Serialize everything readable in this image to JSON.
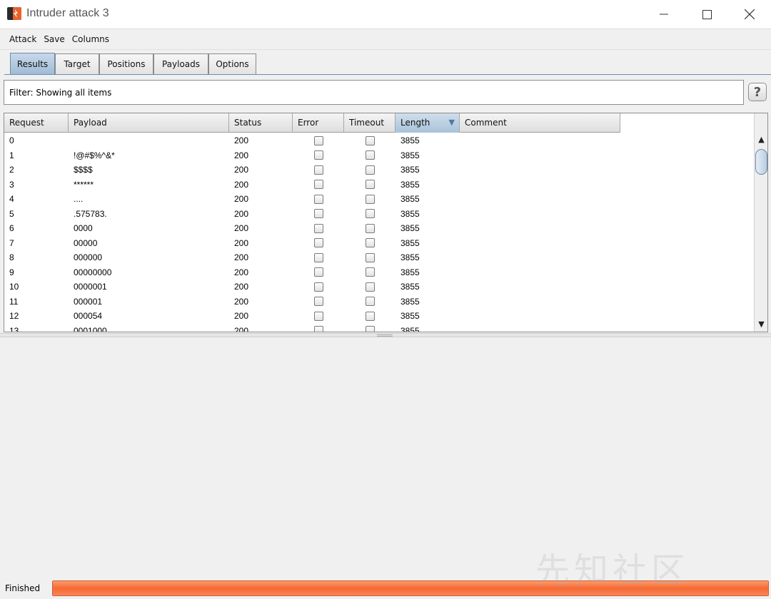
{
  "window": {
    "title": "Intruder attack 3"
  },
  "menu": [
    "Attack",
    "Save",
    "Columns"
  ],
  "tabs": [
    "Results",
    "Target",
    "Positions",
    "Payloads",
    "Options"
  ],
  "active_tab": "Results",
  "filter": {
    "text": "Filter: Showing all items",
    "help_label": "?"
  },
  "table": {
    "columns": [
      "Request",
      "Payload",
      "Status",
      "Error",
      "Timeout",
      "Length",
      "Comment"
    ],
    "sorted_column": "Length",
    "rows": [
      {
        "request": "0",
        "payload": "",
        "status": "200",
        "length": "3855"
      },
      {
        "request": "1",
        "payload": "!@#$%^&*",
        "status": "200",
        "length": "3855"
      },
      {
        "request": "2",
        "payload": "$$$$",
        "status": "200",
        "length": "3855"
      },
      {
        "request": "3",
        "payload": "******",
        "status": "200",
        "length": "3855"
      },
      {
        "request": "4",
        "payload": "....",
        "status": "200",
        "length": "3855"
      },
      {
        "request": "5",
        "payload": ".575783.",
        "status": "200",
        "length": "3855"
      },
      {
        "request": "6",
        "payload": "0000",
        "status": "200",
        "length": "3855"
      },
      {
        "request": "7",
        "payload": "00000",
        "status": "200",
        "length": "3855"
      },
      {
        "request": "8",
        "payload": "000000",
        "status": "200",
        "length": "3855"
      },
      {
        "request": "9",
        "payload": "00000000",
        "status": "200",
        "length": "3855"
      },
      {
        "request": "10",
        "payload": "0000001",
        "status": "200",
        "length": "3855"
      },
      {
        "request": "11",
        "payload": "000001",
        "status": "200",
        "length": "3855"
      },
      {
        "request": "12",
        "payload": "000054",
        "status": "200",
        "length": "3855"
      },
      {
        "request": "13",
        "payload": "0001000",
        "status": "200",
        "length": "3855"
      }
    ]
  },
  "status": {
    "text": "Finished",
    "progress": 1.0
  },
  "watermark": "先知社区",
  "colors": {
    "progress": "#f56a33",
    "tab_active": "#a9c2d9"
  }
}
